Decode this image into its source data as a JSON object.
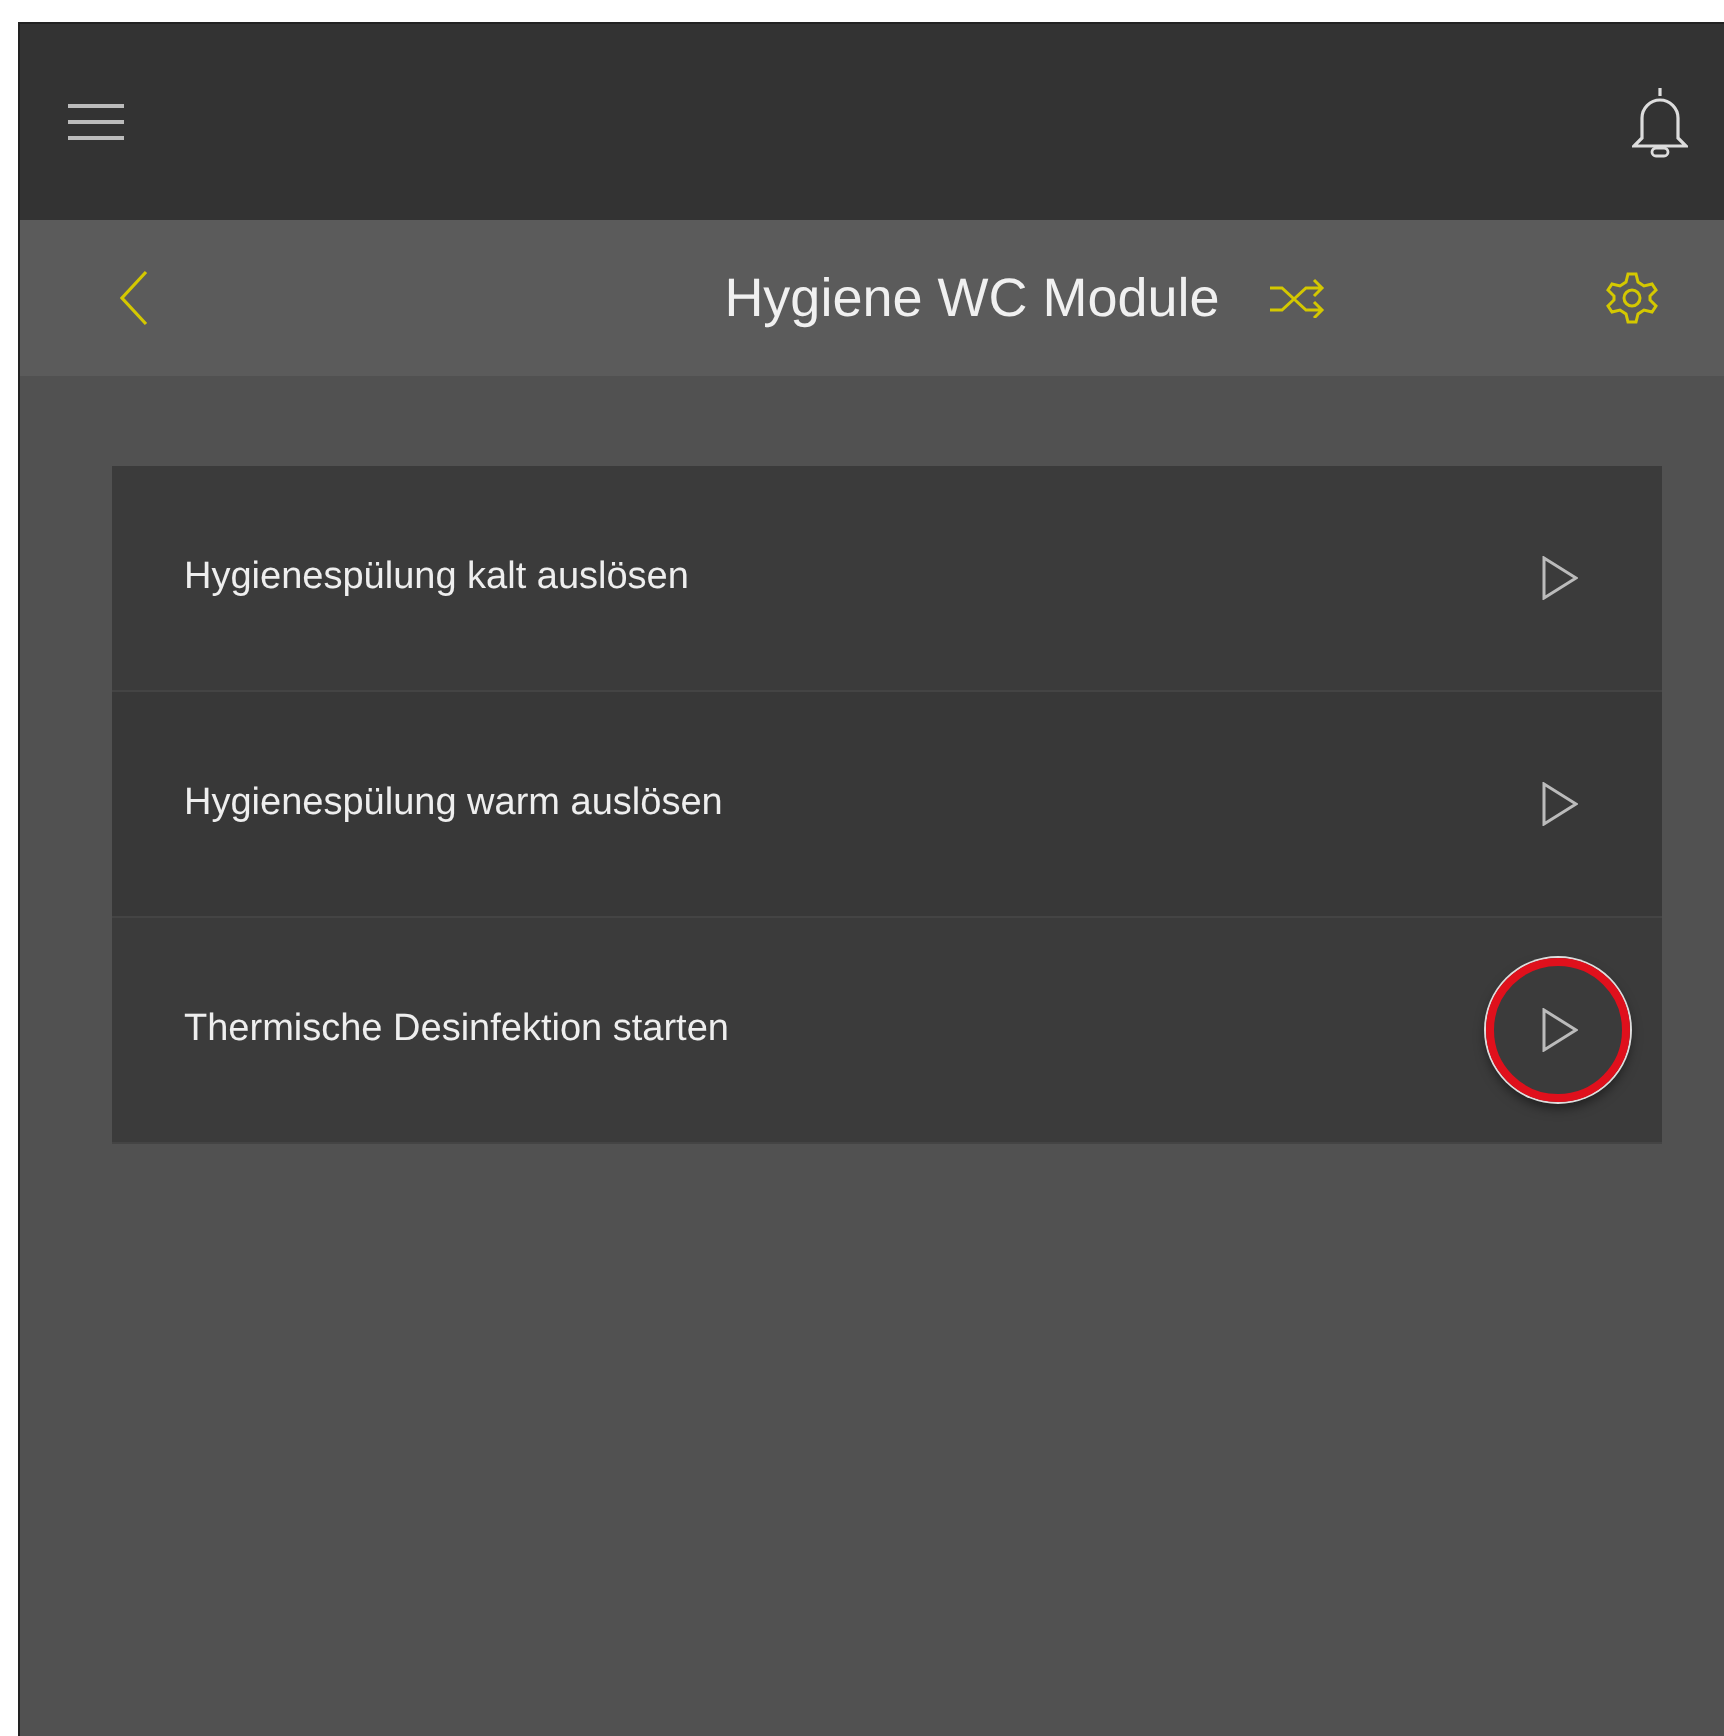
{
  "header": {
    "title": "Hygiene WC Module"
  },
  "actions": [
    {
      "label": "Hygienespülung kalt auslösen",
      "highlighted": false
    },
    {
      "label": "Hygienespülung warm auslösen",
      "highlighted": false
    },
    {
      "label": "Thermische Desinfektion starten",
      "highlighted": true
    }
  ]
}
